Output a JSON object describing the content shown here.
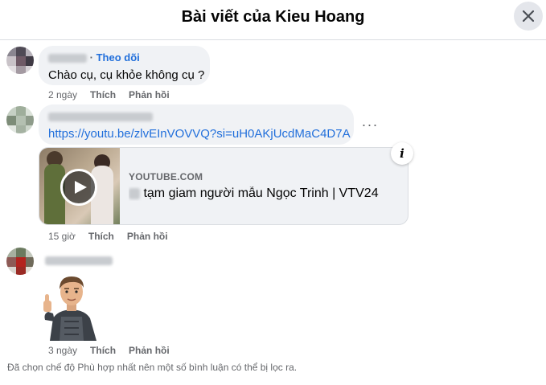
{
  "header": {
    "title": "Bài viết của Kieu Hoang"
  },
  "comments": [
    {
      "follow_label": "Theo dõi",
      "text": "Chào cụ, cụ khỏe không cụ ?",
      "time": "2 ngày",
      "like": "Thích",
      "reply": "Phản hồi"
    },
    {
      "link": "https://youtu.be/zlvEInVOVVQ?si=uH0AKjUcdMaC4D7A",
      "preview": {
        "domain": "YOUTUBE.COM",
        "title": "tạm giam người mẫu Ngọc Trinh | VTV24"
      },
      "time": "15 giờ",
      "like": "Thích",
      "reply": "Phản hồi"
    },
    {
      "sticker": "thumbs-up-man-sticker",
      "time": "3 ngày",
      "like": "Thích",
      "reply": "Phản hồi"
    }
  ],
  "filter_note": "Đã chọn chế độ Phù hợp nhất nên một số bình luận có thể bị lọc ra.",
  "icons": {
    "close": "close-icon",
    "more": "more-options-icon",
    "info": "info-icon",
    "play": "play-icon"
  },
  "colors": {
    "link": "#216fdb",
    "bubble": "#f0f2f5",
    "secondary_text": "#65676b"
  }
}
